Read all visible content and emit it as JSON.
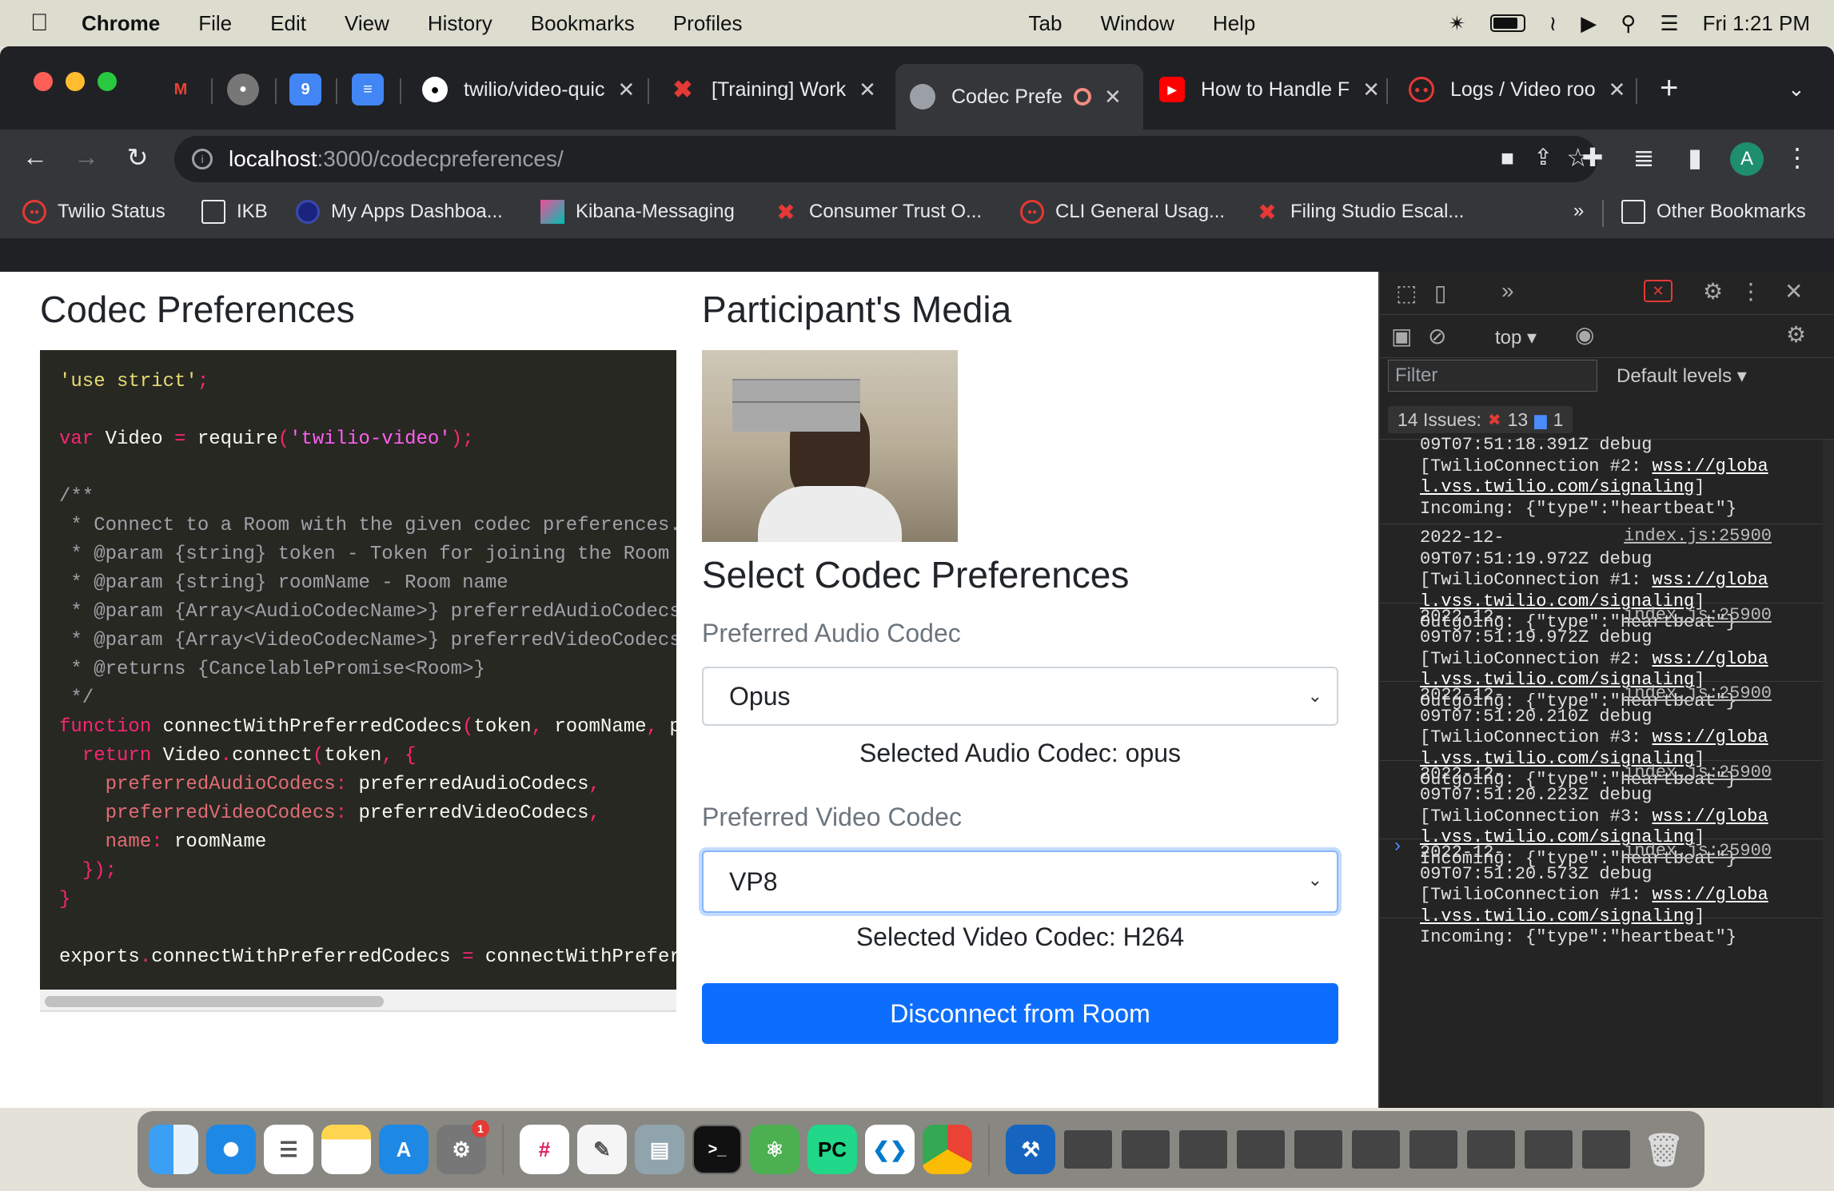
{
  "menubar": {
    "app": "Chrome",
    "items": [
      "File",
      "Edit",
      "View",
      "History",
      "Bookmarks",
      "Profiles",
      "Tab",
      "Window",
      "Help"
    ],
    "clock": "Fri  1:21 PM"
  },
  "tabs": [
    {
      "label": "twilio/video-quic",
      "icon": "github-icon",
      "color": "#ffffff"
    },
    {
      "label": "[Training] Work",
      "icon": "twilio-x-icon",
      "color": "#e53935"
    },
    {
      "label": "Codec Prefe",
      "icon": "globe-icon",
      "color": "#9aa0a6"
    },
    {
      "label": "How to Handle F",
      "icon": "youtube-icon",
      "color": "#ff0000"
    },
    {
      "label": "Logs / Video roo",
      "icon": "twilio-icon",
      "color": "#e53935"
    }
  ],
  "address": {
    "host": "localhost",
    "path": ":3000/codecpreferences/"
  },
  "profile_initial": "A",
  "bookmarks": [
    "Twilio Status",
    "IKB",
    "My Apps Dashboa...",
    "Kibana-Messaging",
    "Consumer Trust O...",
    "CLI General Usag...",
    "Filing Studio Escal...",
    "»",
    "Other Bookmarks"
  ],
  "page": {
    "codec_title": "Codec Preferences",
    "media_title": "Participant's Media",
    "select_title": "Select Codec Preferences",
    "audio_label": "Preferred Audio Codec",
    "audio_value": "Opus",
    "audio_selected": "Selected Audio Codec: opus",
    "video_label": "Preferred Video Codec",
    "video_value": "VP8",
    "video_selected": "Selected Video Codec: H264",
    "disconnect": "Disconnect from Room"
  },
  "devtools": {
    "context": "top",
    "filter_placeholder": "Filter",
    "levels": "Default levels",
    "issues_label": "14 Issues:",
    "issues_errors": "13",
    "issues_info": "1",
    "partial_top": [
      "09T07:51:18.391Z debug",
      "[TwilioConnection #2: ",
      "wss://globa",
      "l.vss.twilio.com/signaling",
      "]",
      "Incoming: {\"type\":\"heartbeat\"}"
    ],
    "logs": [
      {
        "date": "2022-12-",
        "src": "index.js:25900",
        "ts": "09T07:51:19.972Z debug",
        "conn": "[TwilioConnection #1: ",
        "url1": "wss://globa",
        "url2": "l.vss.twilio.com/signaling",
        "end": "]",
        "msg": "Outgoing: {\"type\":\"heartbeat\"}"
      },
      {
        "date": "2022-12-",
        "src": "index.js:25900",
        "ts": "09T07:51:19.972Z debug",
        "conn": "[TwilioConnection #2: ",
        "url1": "wss://globa",
        "url2": "l.vss.twilio.com/signaling",
        "end": "]",
        "msg": "Outgoing: {\"type\":\"heartbeat\"}"
      },
      {
        "date": "2022-12-",
        "src": "index.js:25900",
        "ts": "09T07:51:20.210Z debug",
        "conn": "[TwilioConnection #3: ",
        "url1": "wss://globa",
        "url2": "l.vss.twilio.com/signaling",
        "end": "]",
        "msg": "Outgoing: {\"type\":\"heartbeat\"}"
      },
      {
        "date": "2022-12-",
        "src": "index.js:25900",
        "ts": "09T07:51:20.223Z debug",
        "conn": "[TwilioConnection #3: ",
        "url1": "wss://globa",
        "url2": "l.vss.twilio.com/signaling",
        "end": "]",
        "msg": "Incoming: {\"type\":\"heartbeat\"}"
      },
      {
        "date": "2022-12-",
        "src": "index.js:25900",
        "ts": "09T07:51:20.573Z debug",
        "conn": "[TwilioConnection #1: ",
        "url1": "wss://globa",
        "url2": "l.vss.twilio.com/signaling",
        "end": "]",
        "msg": "Incoming: {\"type\":\"heartbeat\"}"
      }
    ]
  },
  "dock": {
    "apps": [
      "Finder",
      "Safari",
      "Reminders",
      "Notes",
      "App Store",
      "System Preferences",
      "Slack",
      "TextEdit",
      "Preview",
      "Terminal",
      "Atom",
      "PyCharm",
      "VS Code",
      "Chrome"
    ],
    "pycharm_label": "PC",
    "badge": "1"
  },
  "colors": {
    "accent": "#0d6efd",
    "code_bg": "#272822",
    "devtools_bg": "#242424"
  }
}
